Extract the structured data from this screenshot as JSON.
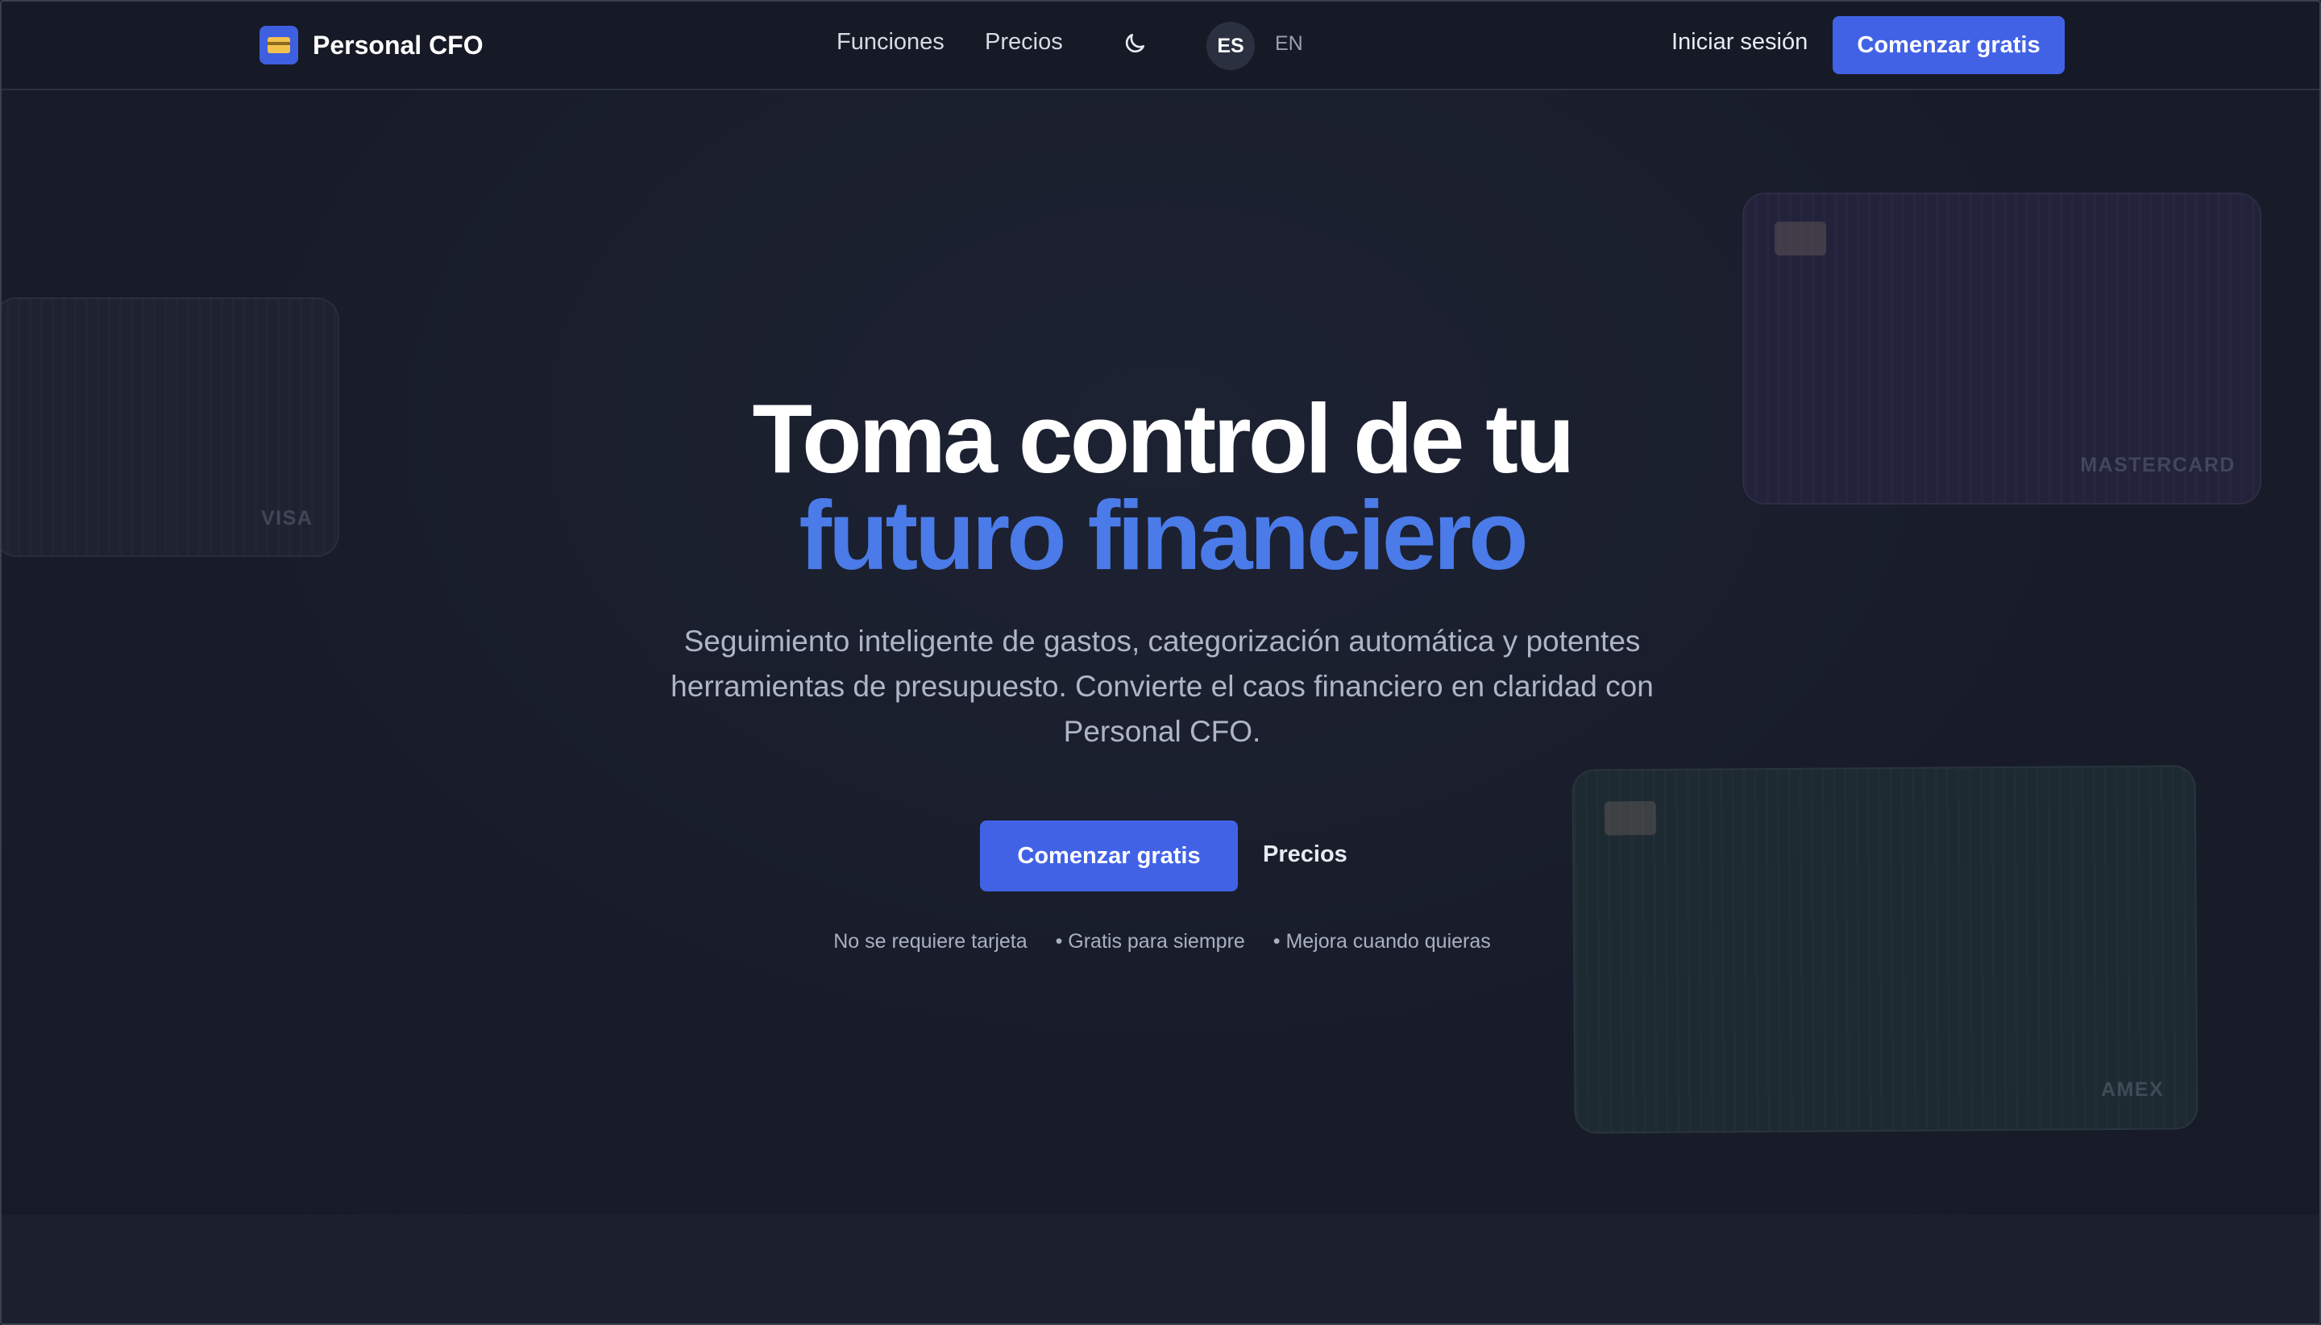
{
  "nav": {
    "brand": "Personal CFO",
    "links": [
      "Funciones",
      "Precios"
    ],
    "theme_icon": "moon-icon",
    "languages": [
      "ES",
      "EN"
    ],
    "active_language": "ES",
    "login": "Iniciar sesión",
    "cta": "Comenzar gratis"
  },
  "hero": {
    "title_line1": "Toma control de tu",
    "title_line2": "futuro financiero",
    "subtitle": "Seguimiento inteligente de gastos, categorización automática y potentes herramientas de presupuesto. Convierte el caos financiero en claridad con Personal CFO.",
    "cta_primary": "Comenzar gratis",
    "cta_secondary": "Precios",
    "features": [
      "No se requiere tarjeta",
      "• Gratis para siempre",
      "• Mejora cuando quieras"
    ]
  },
  "cards": {
    "visa": "VISA",
    "mastercard": "MASTERCARD",
    "amex": "AMEX"
  },
  "colors": {
    "accent": "#4262e6",
    "headline_accent": "#4a7be8",
    "background": "#1a1e2c"
  }
}
